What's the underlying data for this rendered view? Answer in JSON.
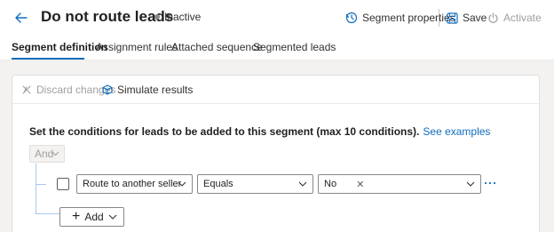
{
  "header": {
    "title": "Do not route leads",
    "status": "Inactive",
    "segment_properties": "Segment properties",
    "save": "Save",
    "activate": "Activate"
  },
  "tabs": [
    {
      "label": "Segment definition",
      "active": true
    },
    {
      "label": "Assignment rules",
      "active": false
    },
    {
      "label": "Attached sequence",
      "active": false
    },
    {
      "label": "Segmented leads",
      "active": false
    }
  ],
  "toolbar": {
    "discard": "Discard changes",
    "simulate": "Simulate results"
  },
  "conditions": {
    "instructions": "Set the conditions for leads to be added to this segment (max 10 conditions).",
    "see_examples": "See examples",
    "group_operator": "And",
    "rows": [
      {
        "field": "Route to another seller",
        "operator": "Equals",
        "value": "No"
      }
    ],
    "add_label": "Add"
  },
  "colors": {
    "accent": "#0f6cbd",
    "tree_line": "#a6c8ee",
    "disabled_text": "#a19f9d"
  },
  "icons": {
    "back": "back-arrow-icon",
    "segment_properties": "history-icon",
    "save": "save-icon",
    "activate": "power-icon",
    "discard": "discard-icon",
    "simulate": "cube-icon"
  }
}
